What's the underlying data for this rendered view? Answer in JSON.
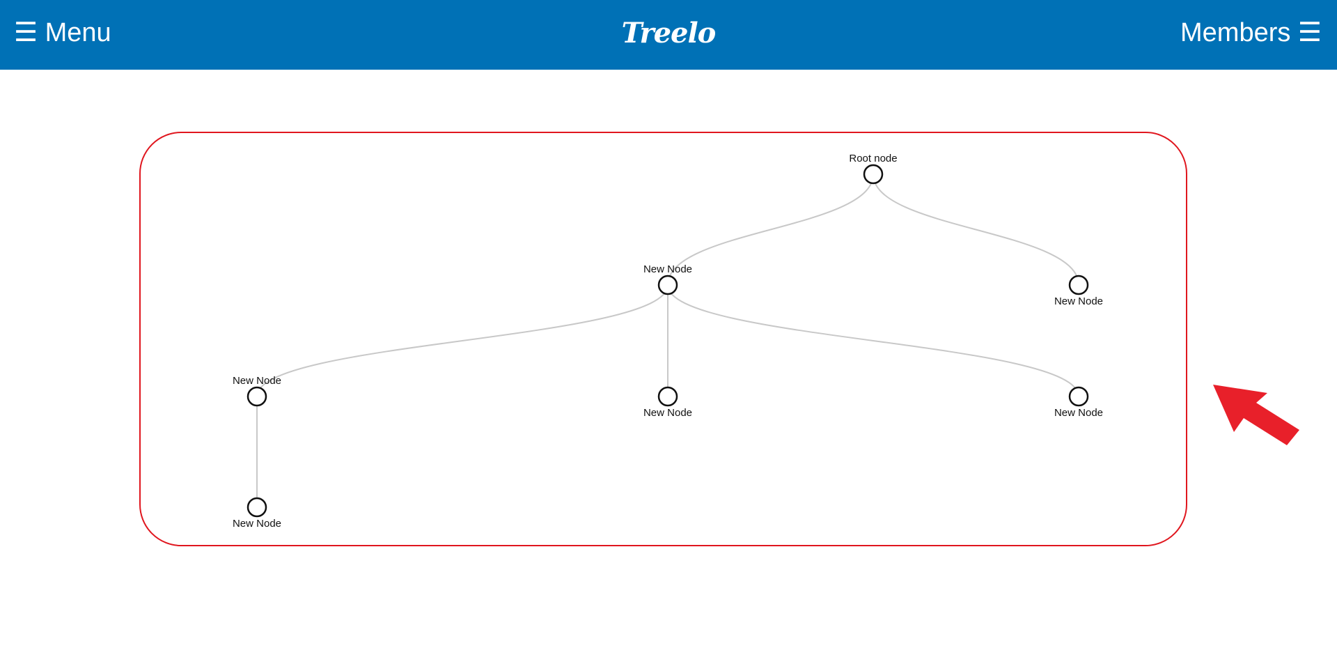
{
  "header": {
    "menu_label": "☰ Menu",
    "logo": "Treelo",
    "members_label": "Members ☰",
    "background_color": "#0071b6"
  },
  "tree": {
    "frame_color": "#e0161e",
    "link_color": "#c8c8c8",
    "nodes": [
      {
        "id": "root",
        "label": "Root node",
        "parent": null
      },
      {
        "id": "n1",
        "label": "New Node",
        "parent": "root"
      },
      {
        "id": "n2",
        "label": "New Node",
        "parent": "root"
      },
      {
        "id": "n3",
        "label": "New Node",
        "parent": "n1"
      },
      {
        "id": "n4",
        "label": "New Node",
        "parent": "n1"
      },
      {
        "id": "n5",
        "label": "New Node",
        "parent": "n1"
      },
      {
        "id": "n6",
        "label": "New Node",
        "parent": "n3"
      }
    ]
  },
  "annotation": {
    "arrow_color": "#e8202a",
    "arrow_icon": "pointer-arrow-icon"
  }
}
